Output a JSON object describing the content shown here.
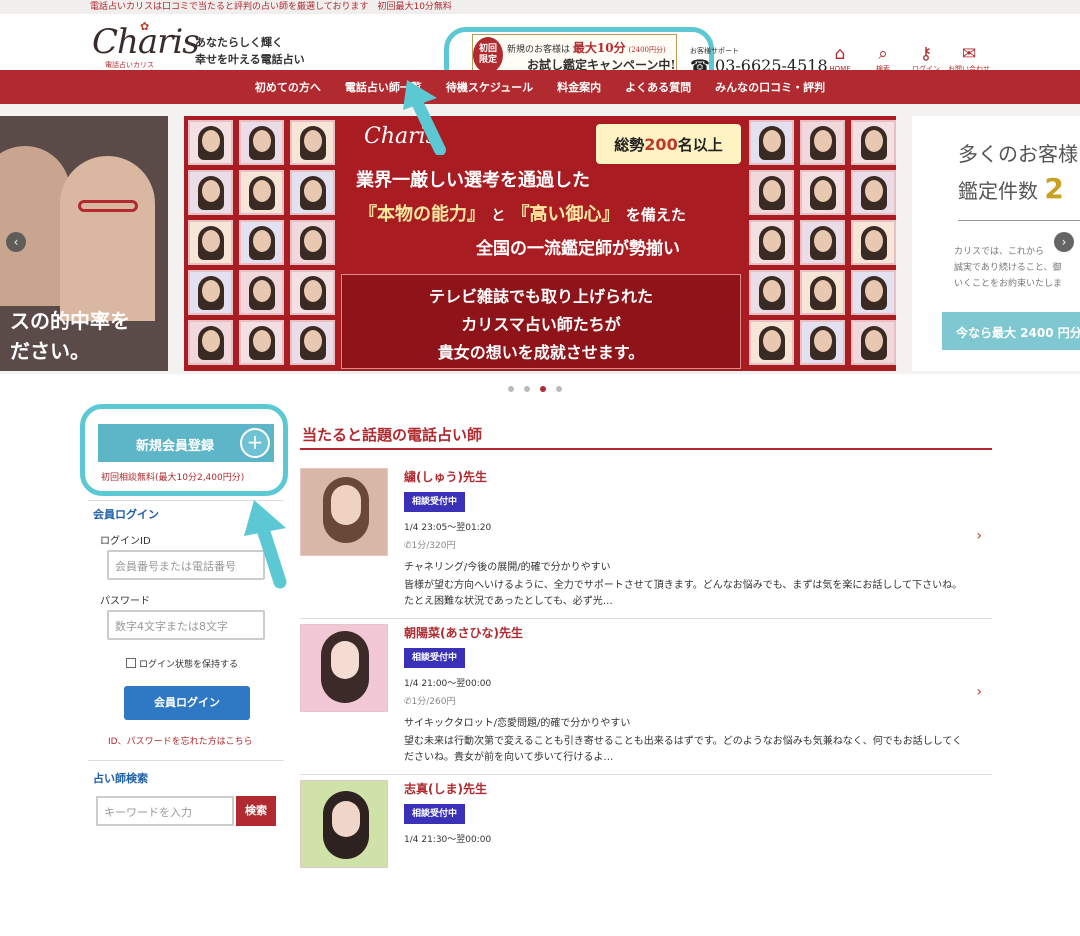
{
  "topbar": {
    "text": "電話占いカリスは口コミで当たると評判の占い師を厳選しております　初回最大10分無料"
  },
  "header": {
    "logo": "Charis",
    "logo_sub": "電話占いカリス",
    "tagline_line1": "あなたらしく輝く",
    "tagline_line2": "幸せを叶える電話占い",
    "campaign_badge_1": "初回",
    "campaign_badge_2": "限定",
    "campaign_line1_pre": "新規のお客様は",
    "campaign_line1_hl": "最大10分",
    "campaign_line1_sm": "(2400円分)",
    "campaign_line2": "お試し鑑定キャンペーン中!",
    "support_label": "お客様サポート",
    "phone": "03-6625-4518",
    "icons": [
      {
        "label": "HOME",
        "icon": "home-icon"
      },
      {
        "label": "検索",
        "icon": "search-icon"
      },
      {
        "label": "ログイン",
        "icon": "key-icon"
      },
      {
        "label": "お問い合わせ",
        "icon": "mail-icon"
      }
    ]
  },
  "nav": [
    "初めての方へ",
    "電話占い師一覧",
    "待機スケジュール",
    "料金案内",
    "よくある質問",
    "みんなの口コミ・評判"
  ],
  "slider": {
    "left_line1": "スの的中率を",
    "left_line2": "ださい。",
    "center_logo": "Charis",
    "badge_pre": "総勢",
    "badge_num": "200",
    "badge_post": "名以上",
    "line1": "業界一厳しい選考を通過した",
    "line2a": "『本物の能力』",
    "line2b": "と",
    "line2c": "『高い御心』",
    "line2d": "を備えた",
    "line3": "全国の一流鑑定師が勢揃い",
    "box1": "テレビ雑誌でも取り上げられた",
    "box2": "カリスマ占い師たちが",
    "box3": "貴女の想いを成就させます。",
    "right_t1": "多くのお客様",
    "right_t2": "鑑定件数",
    "right_t2_num": "2",
    "right_s1": "カリスでは、これから",
    "right_s2": "誠実であり続けること、御",
    "right_s3": "いくことをお約束いたしま",
    "right_cta": "今なら最大 2400 円分",
    "dots_total": 4,
    "dots_active_index": 2
  },
  "sidebar": {
    "register": "新規会員登録",
    "register_plus": "+",
    "register_note": "初回相談無料(最大10分2,400円分)",
    "login_head": "会員ログイン",
    "id_label": "ログインID",
    "id_placeholder": "会員番号または電話番号",
    "pw_label": "パスワード",
    "pw_placeholder": "数字4文字または8文字",
    "remember": "ログイン状態を保持する",
    "login_button": "会員ログイン",
    "forgot": "ID、パスワードを忘れた方はこちら",
    "search_head": "占い師検索",
    "keyword_placeholder": "キーワードを入力",
    "search_button": "検索"
  },
  "main": {
    "title": "当たると話題の電話占い師",
    "cards": [
      {
        "name": "繍(しゅう)先生",
        "status": "相談受付中",
        "time": "1/4 23:05～翌01:20",
        "price": "1分/320円",
        "genre": "チャネリング/今後の展開/的確で分かりやすい",
        "desc": "皆様が望む方向へいけるように、全力でサポートさせて頂きます。どんなお悩みでも、まずは気を楽にお話しして下さいね。たとえ困難な状況であったとしても、必ず光…"
      },
      {
        "name": "朝陽菜(あさひな)先生",
        "status": "相談受付中",
        "time": "1/4 21:00～翌00:00",
        "price": "1分/260円",
        "genre": "サイキックタロット/恋愛問題/的確で分かりやすい",
        "desc": "望む未来は行動次第で変えることも引き寄せることも出来るはずです。どのようなお悩みも気兼ねなく、何でもお話ししてくださいね。貴女が前を向いて歩いて行けるよ…"
      },
      {
        "name": "志真(しま)先生",
        "status": "相談受付中",
        "time": "1/4 21:30～翌00:00",
        "price": "",
        "genre": "",
        "desc": ""
      }
    ]
  },
  "colors": {
    "brand": "#b02a2f",
    "callout": "#5bc8d4",
    "status": "#3a31b8",
    "login": "#2f78c4"
  }
}
